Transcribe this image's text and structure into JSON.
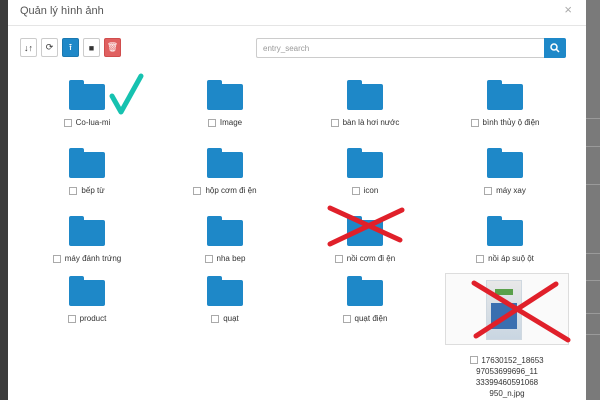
{
  "dialog": {
    "title": "Quản lý hình ảnh",
    "close": "×"
  },
  "toolbar": {
    "buttons": [
      {
        "name": "sort-button",
        "icon": "sort-icon",
        "glyph": "↓↑",
        "style": "default"
      },
      {
        "name": "refresh-button",
        "icon": "refresh-icon",
        "glyph": "⟳",
        "style": "default"
      },
      {
        "name": "upload-button",
        "icon": "upload-icon",
        "glyph": "⭱",
        "style": "primary"
      },
      {
        "name": "new-folder-button",
        "icon": "folder-icon",
        "glyph": "■",
        "style": "default"
      },
      {
        "name": "delete-button",
        "icon": "trash-icon",
        "glyph": "🗑",
        "style": "danger"
      }
    ]
  },
  "search": {
    "placeholder": "entry_search",
    "value": ""
  },
  "folders": [
    "Co-lua-mi",
    "Image",
    "bàn là hơi nước",
    "bình thủy ộ điện",
    "bếp từ",
    "hộp cơm đi ện",
    "icon",
    "máy xay",
    "máy đánh trứng",
    "nha bep",
    "nồi cơm đi ện",
    "nồi áp suộ ột",
    "product",
    "quạt",
    "quạt điện"
  ],
  "file": {
    "name_lines": [
      "17630152_18653",
      "97053699696_11 33399460591068",
      "950_n.jpg"
    ]
  },
  "colors": {
    "accent": "#1e88c8",
    "danger": "#e06060",
    "checkmark": "#16c2b0",
    "cross": "#e0202a"
  }
}
